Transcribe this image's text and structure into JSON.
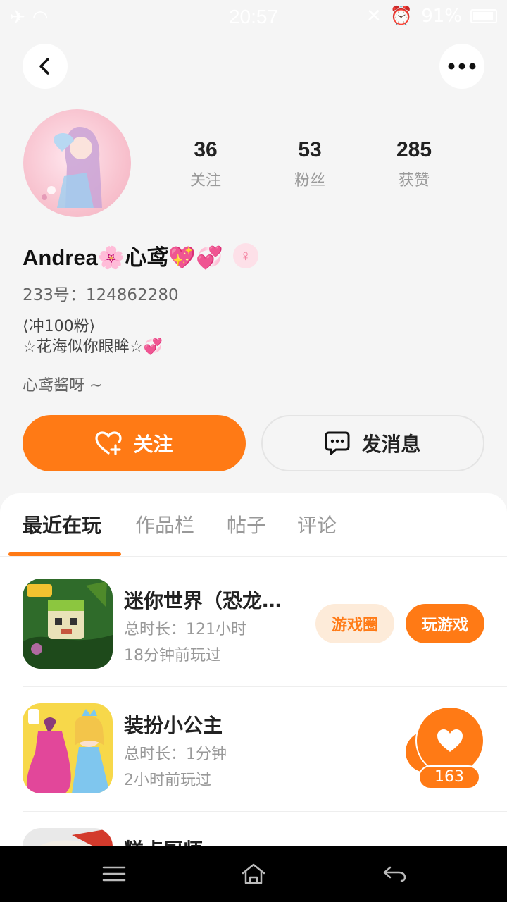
{
  "status_bar": {
    "time": "20:57",
    "battery": "91%"
  },
  "profile": {
    "stats": [
      {
        "value": "36",
        "label": "关注"
      },
      {
        "value": "53",
        "label": "粉丝"
      },
      {
        "value": "285",
        "label": "获赞"
      }
    ],
    "username": "Andrea🌸心鸢💖💞",
    "gender": "♀",
    "id_line": "233号：124862280",
    "bio_line1": "⟨冲100粉⟩",
    "bio_line2": "☆花海似你眼眸☆💞",
    "signature": "心鸢酱呀 ~"
  },
  "actions": {
    "follow_label": "关注",
    "message_label": "发消息"
  },
  "tabs": [
    {
      "label": "最近在玩"
    },
    {
      "label": "作品栏"
    },
    {
      "label": "帖子"
    },
    {
      "label": "评论"
    }
  ],
  "games": [
    {
      "name": "迷你世界（恐龙危机）",
      "duration": "总时长：121小时",
      "last_played": "18分钟前玩过",
      "circle_label": "游戏圈",
      "play_label": "玩游戏"
    },
    {
      "name": "装扮小公主",
      "duration": "总时长：1分钟",
      "last_played": "2小时前玩过"
    },
    {
      "name": "糕点厨师"
    }
  ],
  "like_float": {
    "count": "163"
  },
  "colors": {
    "accent": "#ff7a15",
    "accent_soft": "#fdebd9",
    "page_bg": "#f5f5f5"
  }
}
